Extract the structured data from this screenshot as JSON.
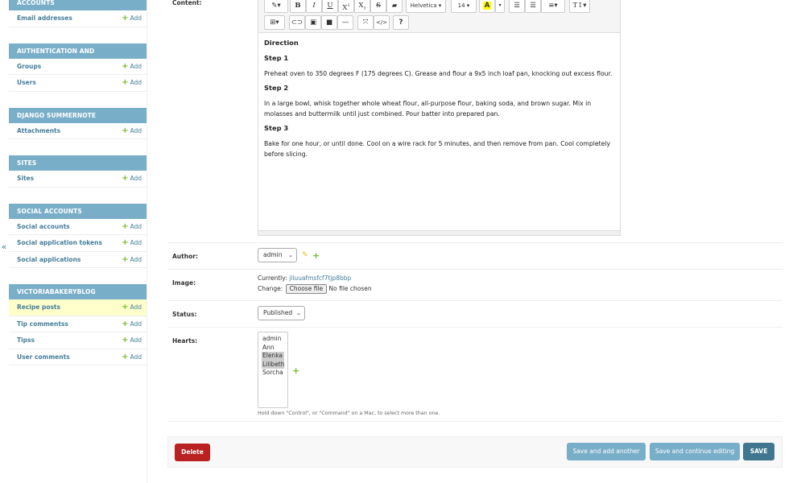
{
  "sidebar": {
    "add_label": "Add",
    "collapse_label": "«",
    "modules": [
      {
        "title": "ACCOUNTS",
        "rows": [
          {
            "label": "Email addresses",
            "selected": false
          }
        ]
      },
      {
        "title": "AUTHENTICATION AND AUTHORIZATION",
        "rows": [
          {
            "label": "Groups"
          },
          {
            "label": "Users"
          }
        ]
      },
      {
        "title": "DJANGO SUMMERNOTE",
        "rows": [
          {
            "label": "Attachments"
          }
        ]
      },
      {
        "title": "SITES",
        "rows": [
          {
            "label": "Sites"
          }
        ]
      },
      {
        "title": "SOCIAL ACCOUNTS",
        "rows": [
          {
            "label": "Social accounts"
          },
          {
            "label": "Social application tokens"
          },
          {
            "label": "Social applications"
          }
        ]
      },
      {
        "title": "VICTORIABAKERYBLOG",
        "rows": [
          {
            "label": "Recipe posts",
            "selected": true
          },
          {
            "label": "Tip commentss"
          },
          {
            "label": "Tipss"
          },
          {
            "label": "User comments"
          }
        ]
      }
    ]
  },
  "form": {
    "content_label": "Content:",
    "author_label": "Author:",
    "image_label": "Image:",
    "status_label": "Status:",
    "hearts_label": "Hearts:",
    "author_value": "admin",
    "image_currently_label": "Currently:",
    "image_currently_value": "jlluuafmsfcf7tjp8bbp",
    "image_change_label": "Change:",
    "choose_file_label": "Choose file",
    "no_file_label": "No file chosen",
    "status_value": "Published",
    "hearts_options": [
      {
        "label": "admin",
        "selected": false
      },
      {
        "label": "Ann",
        "selected": false
      },
      {
        "label": "Elenka",
        "selected": true
      },
      {
        "label": "Lilibeth",
        "selected": true
      },
      {
        "label": "Sorcha",
        "selected": false
      }
    ],
    "hearts_help": "Hold down \"Control\", or \"Command\" on a Mac, to select more than one."
  },
  "editor": {
    "font_family": "Helvetica",
    "font_size": "14",
    "content": [
      {
        "type": "heading",
        "text": "Direction"
      },
      {
        "type": "heading",
        "text": "Step 1"
      },
      {
        "type": "para",
        "text": "Preheat oven to 350 degrees F (175 degrees C). Grease and flour a 9x5 inch loaf pan, knocking out excess flour."
      },
      {
        "type": "heading",
        "text": "Step 2"
      },
      {
        "type": "para",
        "text": "In a large bowl, whisk together whole wheat flour, all-purpose flour, baking soda, and brown sugar. Mix in molasses and buttermilk until just combined. Pour batter into prepared pan."
      },
      {
        "type": "heading",
        "text": "Step 3"
      },
      {
        "type": "para",
        "text": "Bake for one hour, or until done. Cool on a wire rack for 5 minutes, and then remove from pan. Cool completely before slicing."
      }
    ]
  },
  "actions": {
    "delete_label": "Delete",
    "save_add_label": "Save and add another",
    "save_continue_label": "Save and continue editing",
    "save_label": "SAVE"
  },
  "colors": {
    "module_header": "#79aec8",
    "link": "#447e9b",
    "add_green": "#70bf2b",
    "delete_red": "#ba2121",
    "save_dark": "#417690",
    "save_light": "#79aec8",
    "selected_row": "#ffffcc"
  }
}
